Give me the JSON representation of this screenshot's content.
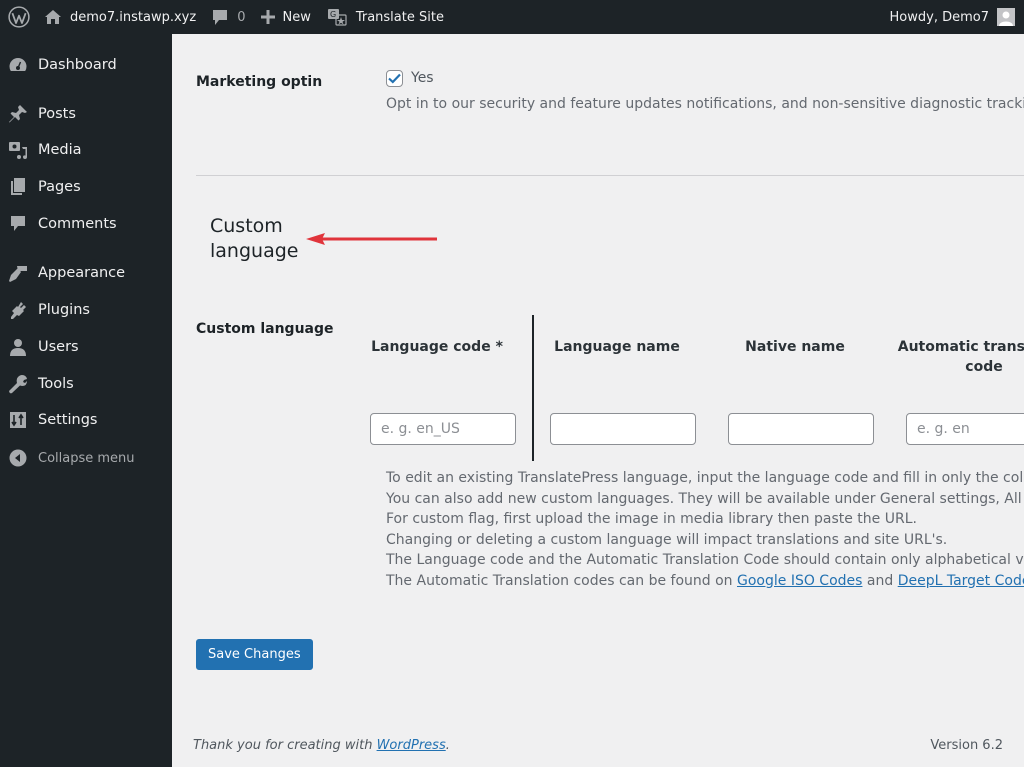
{
  "adminbar": {
    "site_name": "demo7.instawp.xyz",
    "comments_count": "0",
    "new_label": "New",
    "translate_label": "Translate Site",
    "howdy": "Howdy, Demo7"
  },
  "sidebar": {
    "items": [
      {
        "label": "Dashboard",
        "icon": "dashboard-icon"
      },
      {
        "label": "Posts",
        "icon": "pin-icon"
      },
      {
        "label": "Media",
        "icon": "media-icon"
      },
      {
        "label": "Pages",
        "icon": "pages-icon"
      },
      {
        "label": "Comments",
        "icon": "comment-icon"
      },
      {
        "label": "Appearance",
        "icon": "paintbrush-icon"
      },
      {
        "label": "Plugins",
        "icon": "plug-icon"
      },
      {
        "label": "Users",
        "icon": "user-icon"
      },
      {
        "label": "Tools",
        "icon": "wrench-icon"
      },
      {
        "label": "Settings",
        "icon": "sliders-icon"
      }
    ],
    "collapse_label": "Collapse menu"
  },
  "marketing": {
    "label": "Marketing optin",
    "checked": true,
    "checkbox_label": "Yes",
    "description": "Opt in to our security and feature updates notifications, and non-sensitive diagnostic tracking."
  },
  "section": {
    "title": "Custom language",
    "arrow_color": "#e0343b"
  },
  "custom_language": {
    "label": "Custom language",
    "columns": [
      {
        "header": "Language code *",
        "placeholder": "e. g. en_US",
        "value": ""
      },
      {
        "header": "Language name",
        "placeholder": "",
        "value": ""
      },
      {
        "header": "Native name",
        "placeholder": "",
        "value": ""
      },
      {
        "header": "Automatic translation code",
        "placeholder": "e. g. en",
        "value": ""
      }
    ],
    "notes": [
      "To edit an existing TranslatePress language, input the language code and fill in only the columns",
      "You can also add new custom languages. They will be available under General settings, All Langu",
      "For custom flag, first upload the image in media library then paste the URL.",
      "Changing or deleting a custom language will impact translations and site URL's.",
      "The Language code and the Automatic Translation Code should contain only alphabetical values"
    ],
    "last_note": {
      "prefix": "The Automatic Translation codes can be found on ",
      "link1": "Google ISO Codes",
      "middle": " and ",
      "link2": "DeepL Target Codes",
      "suffix": "."
    }
  },
  "save_button": "Save Changes",
  "footer": {
    "thanks_prefix": "Thank you for creating with ",
    "thanks_link": "WordPress",
    "thanks_suffix": ".",
    "version": "Version 6.2"
  },
  "colors": {
    "accent": "#2271b1",
    "adminbar_bg": "#1d2327",
    "page_bg": "#f0f0f1"
  }
}
